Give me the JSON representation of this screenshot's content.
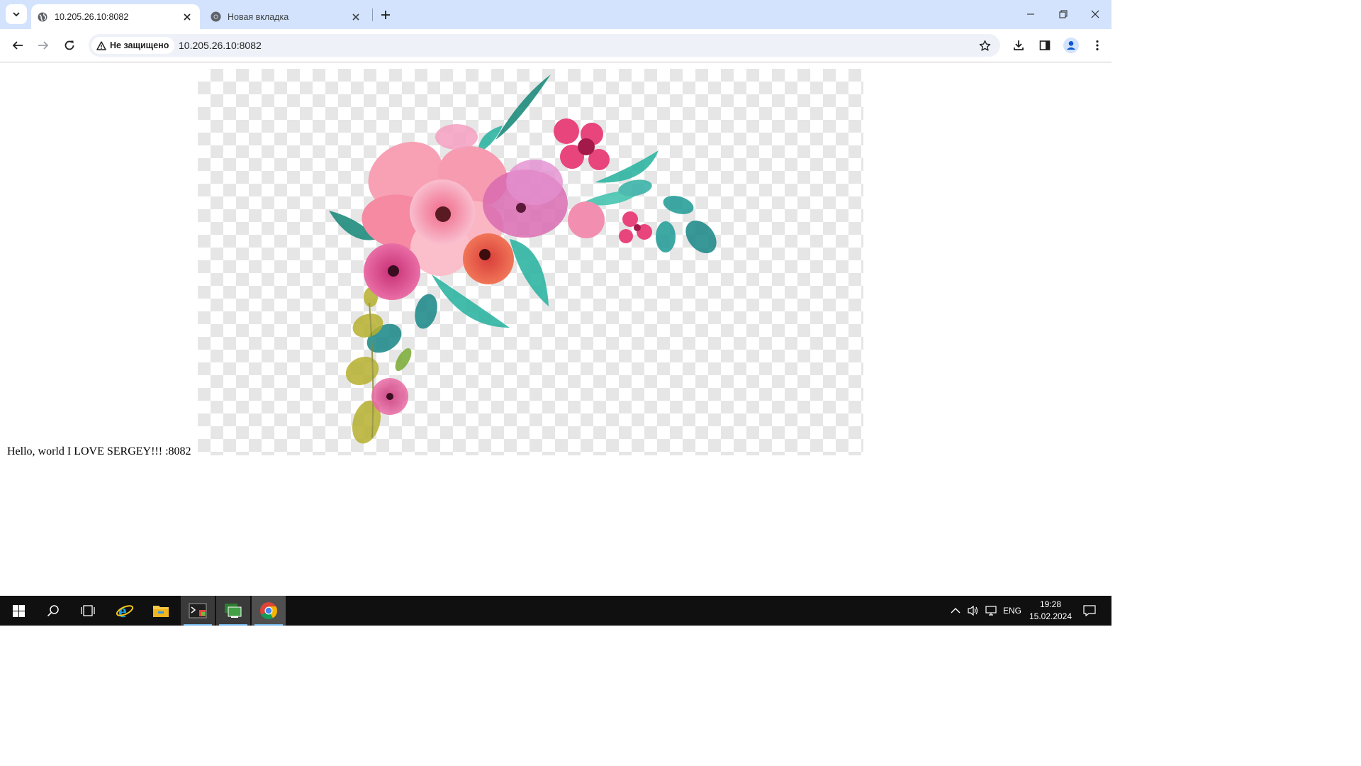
{
  "browser": {
    "tabs": [
      {
        "title": "10.205.26.10:8082",
        "active": true,
        "favicon": "globe-icon"
      },
      {
        "title": "Новая вкладка",
        "active": false,
        "favicon": "chrome-icon"
      }
    ],
    "security_label": "Не защищено",
    "url": "10.205.26.10:8082"
  },
  "page": {
    "text": "Hello, world I LOVE SERGEY!!! :8082",
    "image": {
      "subject": "watercolor-flower-bouquet",
      "background": "transparency-checkerboard"
    }
  },
  "taskbar": {
    "apps": [
      "start-icon",
      "search-icon",
      "task-view-icon",
      "internet-explorer-icon",
      "file-explorer-icon",
      "terminal-app-icon",
      "remote-desktop-icon",
      "chrome-icon"
    ],
    "active_app": "chrome-icon",
    "language": "ENG",
    "time": "19:28",
    "date": "15.02.2024"
  },
  "colors": {
    "tabstrip": "#d3e3fd",
    "omnibox": "#eef1f8",
    "taskbar": "#101010",
    "petal_pink": "#f27a9c",
    "leaf_teal": "#2fb5a3"
  }
}
